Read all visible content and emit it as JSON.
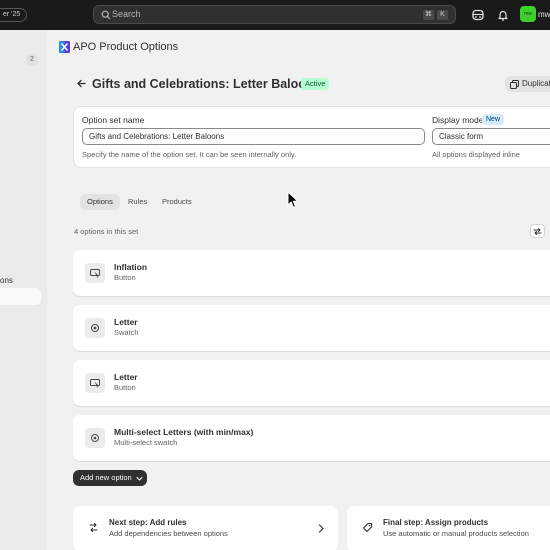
{
  "topbar": {
    "edition_label": "er '25",
    "search_placeholder": "Search",
    "shortcut_keys": [
      "⌘",
      "K"
    ],
    "store_avatar": "mw",
    "store_name": "mw",
    "store_color": "#3fd12b"
  },
  "sidebar": {
    "badge_count": "2",
    "section_label": "ons"
  },
  "app": {
    "title": "APO Product Options"
  },
  "page": {
    "title": "Gifts and Celebrations: Letter Baloons",
    "status": "Active",
    "duplicate_label": "Duplicate"
  },
  "settings": {
    "name_label": "Option set name",
    "name_value": "Gifts and Celebrations: Letter Baloons",
    "name_help": "Specify the name of the option set. It can be seen internally only.",
    "display_label": "Display mode",
    "display_badge": "New",
    "display_value": "Classic form",
    "display_help": "All options displayed inline"
  },
  "tabs": [
    {
      "label": "Options",
      "active": true
    },
    {
      "label": "Rules",
      "active": false
    },
    {
      "label": "Products",
      "active": false
    }
  ],
  "options_count_text": "4 options in this set",
  "options": [
    {
      "name": "Inflation",
      "type": "Button",
      "icon": "button-icon"
    },
    {
      "name": "Letter",
      "type": "Swatch",
      "icon": "swatch-icon"
    },
    {
      "name": "Letter",
      "type": "Button",
      "icon": "button-icon"
    },
    {
      "name": "Multi-select Letters (with min/max)",
      "type": "Multi-select swatch",
      "icon": "swatch-icon"
    }
  ],
  "add_option_label": "Add new option",
  "steps": [
    {
      "title": "Next step: Add rules",
      "desc": "Add dependencies between options"
    },
    {
      "title": "Final step: Assign products",
      "desc": "Use automatic or manual products selection"
    }
  ]
}
